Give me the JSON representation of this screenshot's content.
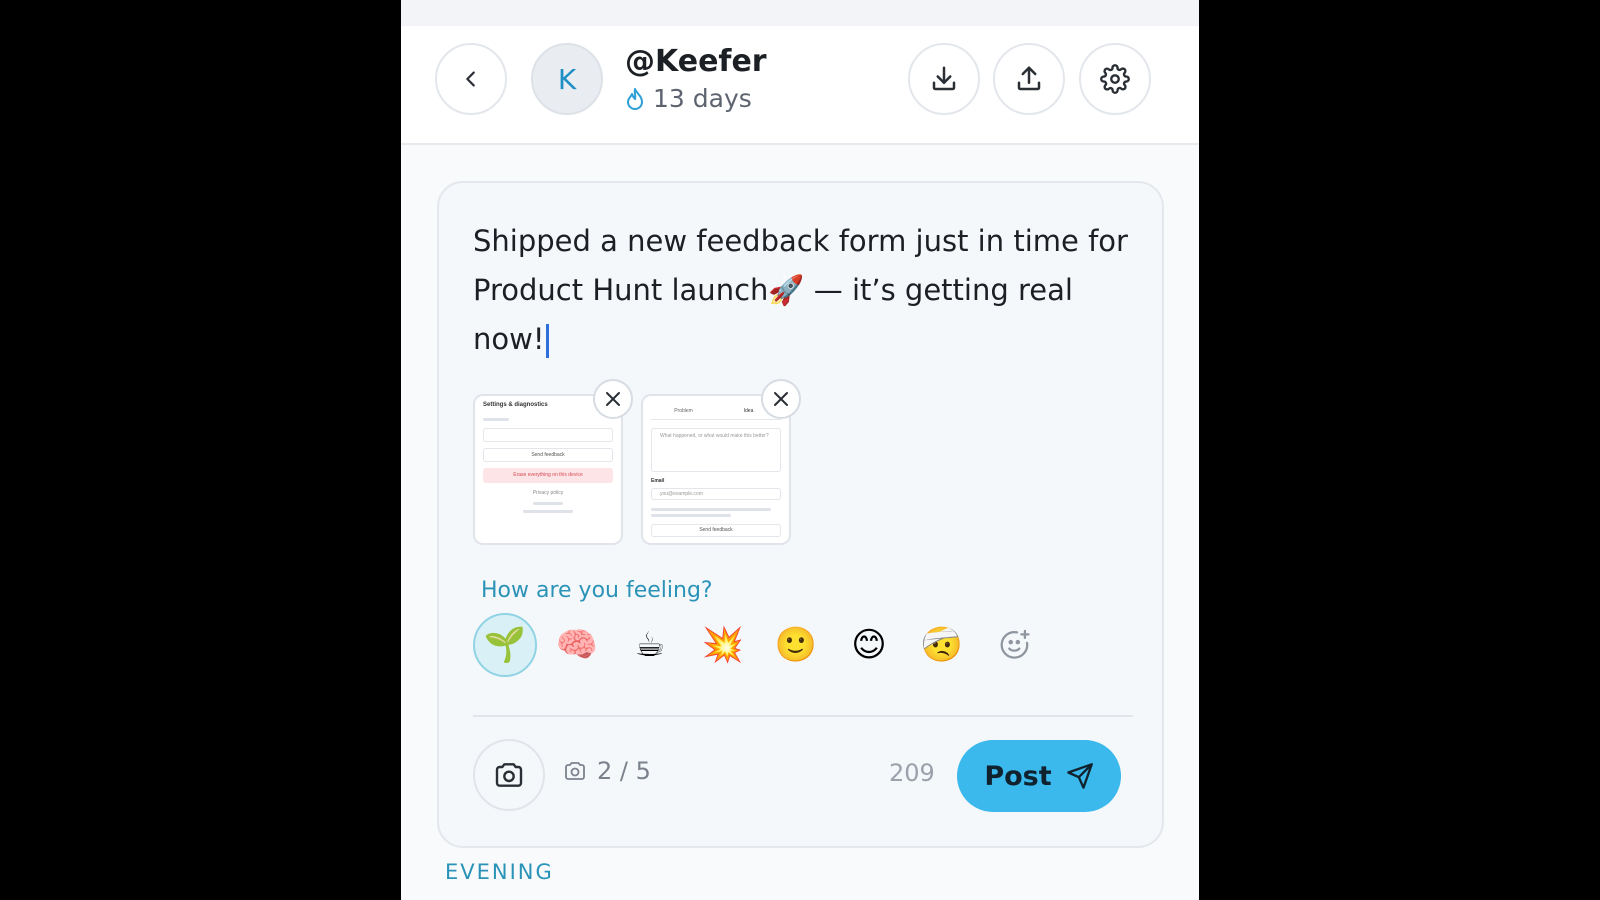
{
  "header": {
    "avatar_initial": "K",
    "username": "@Keefer",
    "streak_text": "13 days",
    "icons": {
      "back": "chevron-left-icon",
      "download": "download-icon",
      "upload": "upload-icon",
      "settings": "gear-icon",
      "streak": "flame-icon"
    }
  },
  "composer": {
    "text_line1": "Shipped a new feedback form just in time for",
    "text_line2_before": "Product Hunt launch",
    "text_line2_emoji": "🚀",
    "text_line2_after": " — it’s getting real now!",
    "attachments": [
      {
        "title": "Settings & diagnostics",
        "button": "Send feedback",
        "danger": "Erase everything on this device",
        "footer": "Privacy policy"
      },
      {
        "tabs": [
          "Problem",
          "Idea"
        ],
        "prompt": "What happened, or what would make this better?",
        "email_label": "Email",
        "email_placeholder": "you@example.com",
        "button": "Send feedback"
      }
    ],
    "feeling_label": "How are you feeling?",
    "moods": [
      "🌱",
      "🧠",
      "☕",
      "💥",
      "🙂",
      "😊",
      "🤕"
    ],
    "selected_mood_index": 0,
    "photo_count": "2 / 5",
    "char_count": "209",
    "post_label": "Post"
  },
  "section": {
    "label": "EVENING"
  },
  "colors": {
    "accent": "#3bb8ec",
    "label_teal": "#2b93b8",
    "avatar_text": "#1f8fc6"
  }
}
